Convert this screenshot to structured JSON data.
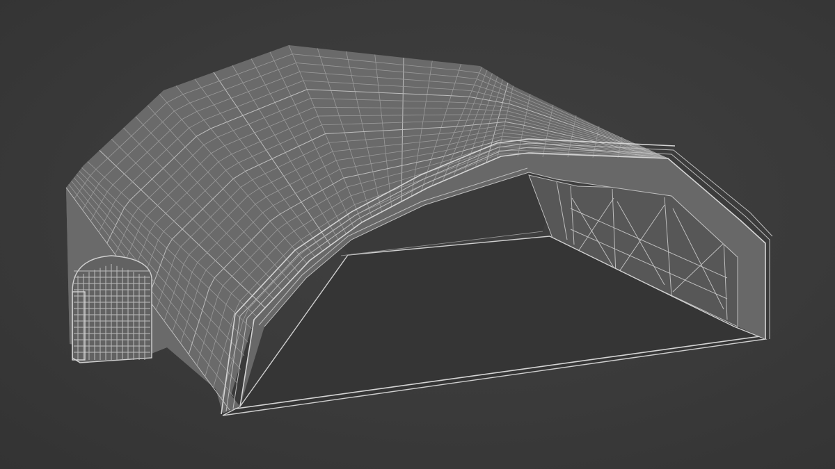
{
  "scene": {
    "subject": "hangar-tent-wireframe",
    "colors": {
      "background": "#3b3b3b",
      "roof_surface": "#676767",
      "roof_shade": "#5a5a5a",
      "interior_floor": "#333333",
      "back_wall": "#555555",
      "wire": "#bdbdbd",
      "wire_highlight": "#d8d8d8"
    }
  }
}
